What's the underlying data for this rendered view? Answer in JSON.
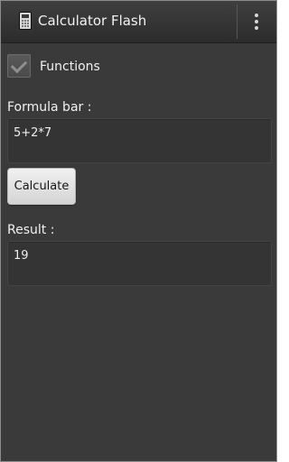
{
  "header": {
    "title": "Calculator Flash",
    "app_icon": "calculator-icon",
    "overflow_icon": "overflow-menu-icon"
  },
  "functions": {
    "label": "Functions",
    "checkbox_state": "checked",
    "check_icon": "checkmark-icon"
  },
  "formula": {
    "label": "Formula bar :",
    "value": "5+2*7"
  },
  "calculate_button": {
    "label": "Calculate"
  },
  "result": {
    "label": "Result :",
    "value": "19"
  },
  "colors": {
    "background": "#3a3a3a",
    "action_bar": "#333333",
    "text": "#f1f1f1",
    "button": "#e6e6e6"
  }
}
